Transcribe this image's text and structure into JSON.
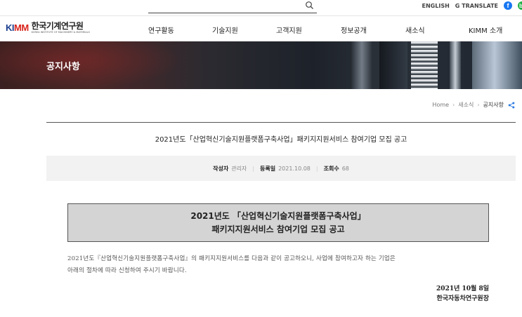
{
  "util": {
    "links": [
      "ENGLISH",
      "G TRANSLATE"
    ],
    "icons": [
      "facebook-icon",
      "naver-blog-icon"
    ],
    "fb_glyph": "f",
    "nb_glyph": "b"
  },
  "logo": {
    "mark_a": "KI",
    "mark_b": "MM",
    "kor": "한국기계연구원",
    "eng": "KOREA INSTITUTE OF MACHINERY & MATERIALS"
  },
  "nav": {
    "items": [
      "연구활동",
      "기술지원",
      "고객지원",
      "정보공개",
      "새소식",
      "KIMM 소개"
    ]
  },
  "banner": {
    "title": "공지사항"
  },
  "breadcrumb": {
    "home": "Home",
    "level1": "새소식",
    "current": "공지사항",
    "sep": "›"
  },
  "post": {
    "title": "2021년도「산업혁신기술지원플랫폼구축사업」패키지지원서비스 참여기업 모집 공고",
    "author_label": "작성자",
    "author": "관리자",
    "date_label": "등록일",
    "date": "2021.10.08",
    "views_label": "조회수",
    "views": "68",
    "meta_sep": "|"
  },
  "notice_box": {
    "line1": "2021년도 「산업혁신기술지원플랫폼구축사업」",
    "line2": "패키지지원서비스 참여기업 모집 공고"
  },
  "body": {
    "line1": "2021년도『산업혁신기술지원플랫폼구축사업』의 패키지지원서비스를 다음과 같이 공고하오니, 사업에 참여하고자 하는 기업은",
    "line2": "아래의 절차에 따라 신청하여 주시기 바랍니다."
  },
  "sign": {
    "date": "2021년 10월 8일",
    "org": "한국자동차연구원장"
  },
  "colors": {
    "facebook": "#1877f2",
    "naver": "#1fb144",
    "logo_blue": "#1b3e8f",
    "logo_red": "#d9241c",
    "share_accent": "#2d7be0"
  }
}
